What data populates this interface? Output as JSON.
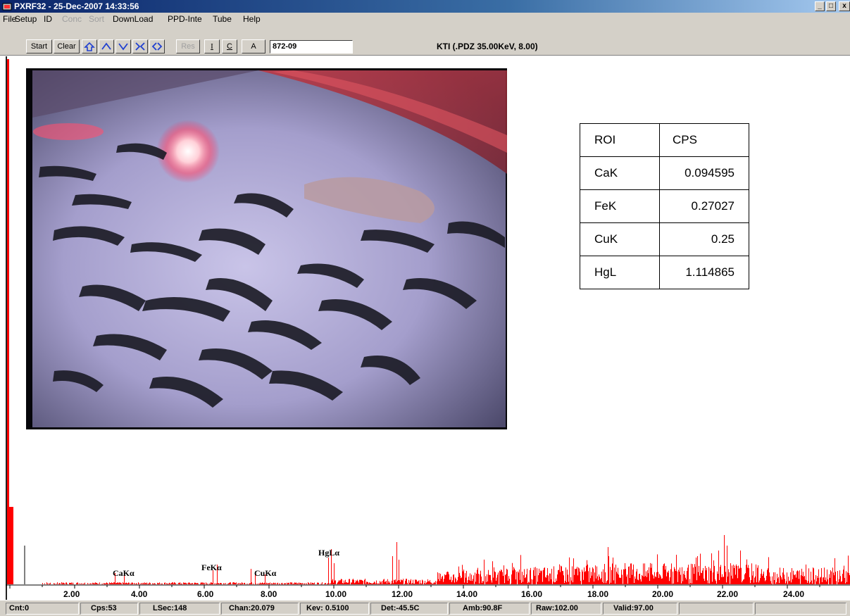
{
  "window": {
    "title": "PXRF32 - 25-Dec-2007 14:33:56",
    "buttons": {
      "minimize": "_",
      "maximize": "□",
      "close": "x"
    }
  },
  "menu": [
    {
      "label": "File",
      "enabled": true
    },
    {
      "label": "Setup",
      "enabled": true
    },
    {
      "label": "ID",
      "enabled": true
    },
    {
      "label": "Conc",
      "enabled": false
    },
    {
      "label": "Sort",
      "enabled": false
    },
    {
      "label": "DownLoad",
      "enabled": true
    },
    {
      "label": "PPD-Inte",
      "enabled": true
    },
    {
      "label": "Tube",
      "enabled": true
    },
    {
      "label": "Help",
      "enabled": true
    }
  ],
  "toolbar": {
    "start": "Start",
    "clear": "Clear",
    "res": "Res",
    "i": "I",
    "c": "C",
    "a": "A",
    "sample_id": "872-09",
    "tube_info": "KTI  (.PDZ 35.00KeV, 8.00)",
    "icons": [
      "save-icon",
      "up-arrow-icon",
      "down-arrow-icon",
      "compress-icon",
      "expand-icon"
    ]
  },
  "roi_table": {
    "headers": [
      "ROI",
      "CPS"
    ],
    "rows": [
      [
        "CaK",
        "0.094595"
      ],
      [
        "FeK",
        "0.27027"
      ],
      [
        "CuK",
        "0.25"
      ],
      [
        "HgL",
        "1.114865"
      ]
    ]
  },
  "peak_labels": [
    "CaKα",
    "FeKα",
    "CuKα",
    "HgLα"
  ],
  "axis": {
    "ticks": [
      "2.00",
      "4.00",
      "6.00",
      "8.00",
      "10.00",
      "12.00",
      "14.00",
      "16.00",
      "18.00",
      "20.00",
      "22.00",
      "24.00"
    ]
  },
  "spectrum_color": "#ff0000",
  "status": {
    "cnt": "Cnt:0",
    "cps": "Cps:53",
    "lsec": "LSec:148",
    "chan": "Chan:20.079",
    "kev": "Kev: 0.5100",
    "det": "Det:-45.5C",
    "amb": "Amb:90.8F",
    "raw": "Raw:102.00",
    "valid": "Valid:97.00"
  }
}
